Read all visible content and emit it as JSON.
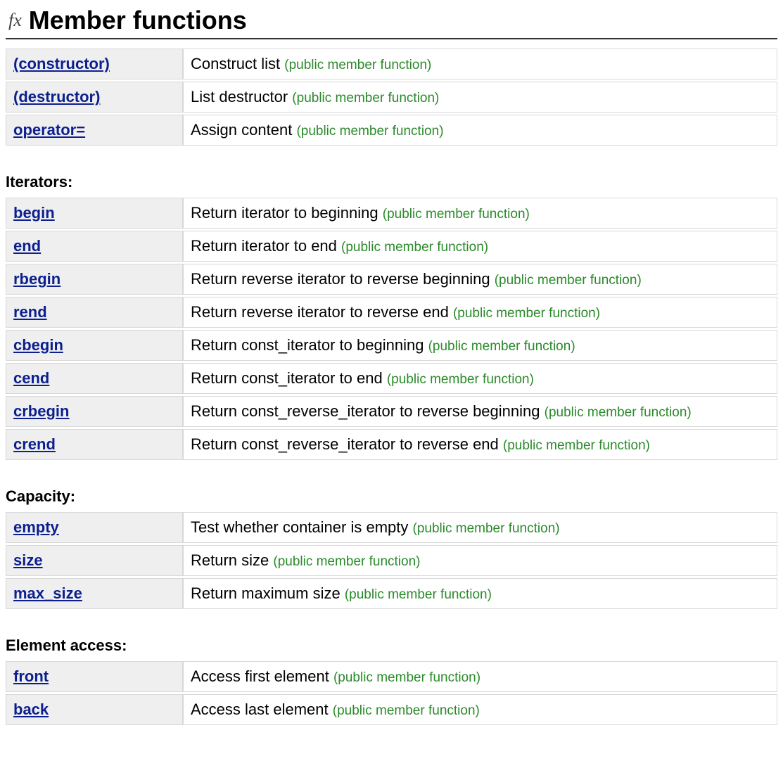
{
  "title": "Member functions",
  "fx": "fx",
  "tag": "(public member function)",
  "main": [
    {
      "name": "(constructor)",
      "desc": "Construct list"
    },
    {
      "name": "(destructor)",
      "desc": "List destructor"
    },
    {
      "name": "operator=",
      "desc": "Assign content"
    }
  ],
  "sections": [
    {
      "title": "Iterators:",
      "rows": [
        {
          "name": "begin",
          "desc": "Return iterator to beginning"
        },
        {
          "name": "end",
          "desc": "Return iterator to end"
        },
        {
          "name": "rbegin",
          "desc": "Return reverse iterator to reverse beginning"
        },
        {
          "name": "rend",
          "desc": "Return reverse iterator to reverse end"
        },
        {
          "name": "cbegin",
          "desc": "Return const_iterator to beginning"
        },
        {
          "name": "cend",
          "desc": "Return const_iterator to end"
        },
        {
          "name": "crbegin",
          "desc": "Return const_reverse_iterator to reverse beginning"
        },
        {
          "name": "crend",
          "desc": "Return const_reverse_iterator to reverse end"
        }
      ]
    },
    {
      "title": "Capacity:",
      "rows": [
        {
          "name": "empty",
          "desc": "Test whether container is empty"
        },
        {
          "name": "size",
          "desc": "Return size"
        },
        {
          "name": "max_size",
          "desc": "Return maximum size"
        }
      ]
    },
    {
      "title": "Element access:",
      "rows": [
        {
          "name": "front",
          "desc": "Access first element"
        },
        {
          "name": "back",
          "desc": "Access last element"
        }
      ]
    }
  ]
}
